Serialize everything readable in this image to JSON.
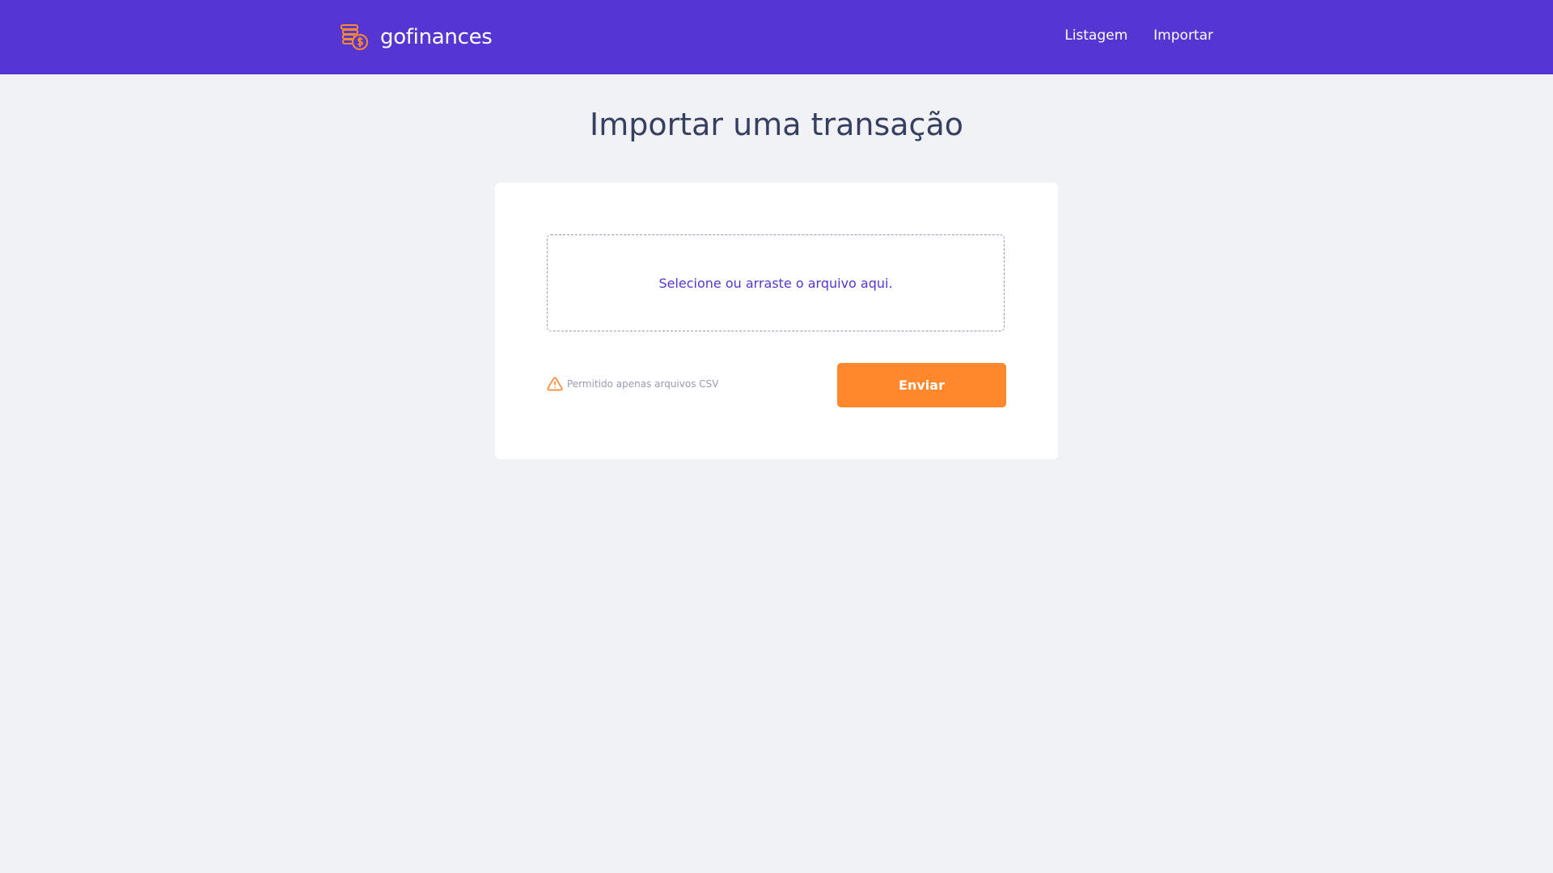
{
  "header": {
    "brand_name": "gofinances",
    "brand_icon": "coins-dollar-icon",
    "nav": [
      {
        "label": "Listagem"
      },
      {
        "label": "Importar"
      }
    ]
  },
  "main": {
    "title": "Importar uma transação",
    "dropzone_text": "Selecione ou arraste o arquivo aqui.",
    "hint_icon": "warning-icon",
    "hint_text": "Permitido apenas arquivos CSV",
    "submit_label": "Enviar"
  },
  "colors": {
    "header_bg": "#5636d3",
    "page_bg": "#f0f2f5",
    "accent": "#ff872c",
    "title_text": "#363f5f",
    "muted_text": "#969cb3",
    "primary_text": "#5636d3"
  }
}
